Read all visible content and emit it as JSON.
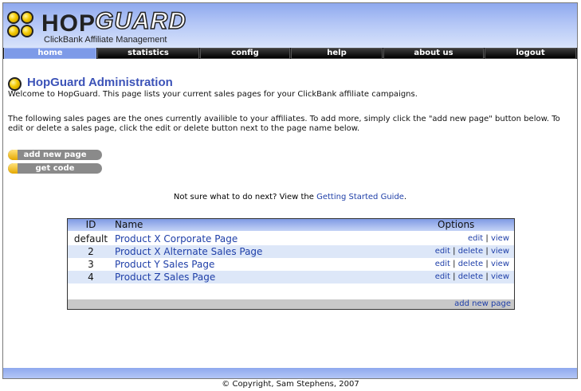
{
  "header": {
    "logo_hop": "HOP",
    "logo_guard": "GUARD",
    "tagline": "ClickBank Affiliate Management"
  },
  "nav": {
    "items": [
      "home",
      "statistics",
      "config",
      "help",
      "about us",
      "logout"
    ],
    "active": "home"
  },
  "page": {
    "title": "HopGuard Administration",
    "welcome": "Welcome to HopGuard. This page lists your current sales pages for your ClickBank affiliate campaigns.",
    "instructions": "The following sales pages are the ones currently availible to your affiliates. To add more, simply click the \"add new page\" button below. To edit or delete a sales page, click the edit or delete button next to the page name below.",
    "add_button": "add new page",
    "get_code_button": "get code",
    "help_prefix": "Not sure what to do next? View the",
    "help_link": "Getting Started Guide",
    "help_suffix": "."
  },
  "table": {
    "headers": {
      "id": "ID",
      "name": "Name",
      "options": "Options"
    },
    "rows": [
      {
        "id": "default",
        "name": "Product X Corporate Page",
        "options": [
          "edit",
          "view"
        ]
      },
      {
        "id": "2",
        "name": "Product X Alternate Sales Page",
        "options": [
          "edit",
          "delete",
          "view"
        ]
      },
      {
        "id": "3",
        "name": "Product Y Sales Page",
        "options": [
          "edit",
          "delete",
          "view"
        ]
      },
      {
        "id": "4",
        "name": "Product Z Sales Page",
        "options": [
          "edit",
          "delete",
          "view"
        ]
      }
    ],
    "footer_link": "add new page",
    "separator": "|"
  },
  "footer": {
    "copyright": "© Copyright, Sam Stephens, 2007"
  },
  "colors": {
    "accent": "#3c53b8",
    "link": "#1f3fa8",
    "header_blue": "#8fa9ee",
    "row_shade": "#dde7f8"
  }
}
